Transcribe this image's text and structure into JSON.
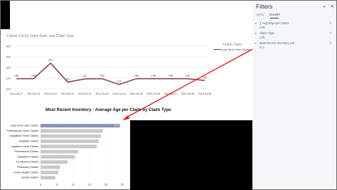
{
  "pane": {
    "title": "Filters",
    "icons": [
      "expand-icon",
      "close-icon"
    ],
    "icon_glyphs": [
      "»",
      "✕"
    ],
    "tabs": [
      "VIEW",
      "CHART"
    ],
    "filters": [
      {
        "name": "∑ Avg Days per Claim",
        "value": "(All)"
      },
      {
        "name": "Claim Type",
        "value": "(All)"
      },
      {
        "name": "Most Recent Inventory Ind",
        "value": "is Y"
      }
    ]
  },
  "line_chart": {
    "title": "Claims Cnt by Claim Date, and Claim Type",
    "legend_title": "Claim Type",
    "legend_items": [
      "Long Term Care Claims"
    ],
    "series_color": "#8b3a3a"
  },
  "bar_chart": {
    "title": "Most Recent Inventory - Average Age per Claim by Claim Type",
    "bar_color": "#c9c9c9",
    "highlight_color": "#8692b6"
  },
  "chart_data": [
    {
      "type": "line",
      "title": "Claims Cnt by Claim Date, and Claim Type",
      "x": [
        "2014-04-17",
        "2014-04-19",
        "2014-04-20",
        "2014-04-21",
        "2014-04-22",
        "2014-04-23",
        "2014-04-24",
        "2014-04-25",
        "2014-04-26",
        "2014-04-27",
        "2014-04-28",
        "2014-04-30"
      ],
      "ylim": [
        100,
        300
      ],
      "yticks": [
        100,
        150,
        200,
        250,
        300
      ],
      "series": [
        {
          "name": "Long Term Care Claims",
          "values": [
            148,
            148,
            221,
            132,
            147,
            148,
            121,
            148,
            148,
            148,
            148,
            140
          ]
        }
      ],
      "grid": true
    },
    {
      "type": "bar",
      "orientation": "horizontal",
      "title": "Most Recent Inventory - Average Age per Claim by Claim Type",
      "categories": [
        "Long Term Care Claims",
        "Professional Xover Claims",
        "Outpatient Xover Claims",
        "Inpatient Claims",
        "Inpatient Xover Claims",
        "Professional Claims",
        "Outpatient Claims",
        "Compound Claims",
        "Pharmacy Claims",
        "Home Health Claims",
        "Dental Claims"
      ],
      "values": [
        24.3,
        19,
        18.5,
        17.8,
        17.2,
        11.5,
        10.5,
        8.3,
        6.0,
        5.5,
        4.5
      ],
      "highlight_label": "24.3",
      "xlim": [
        0,
        25
      ],
      "xticks": [
        0,
        5,
        10,
        15,
        20,
        25
      ]
    }
  ]
}
